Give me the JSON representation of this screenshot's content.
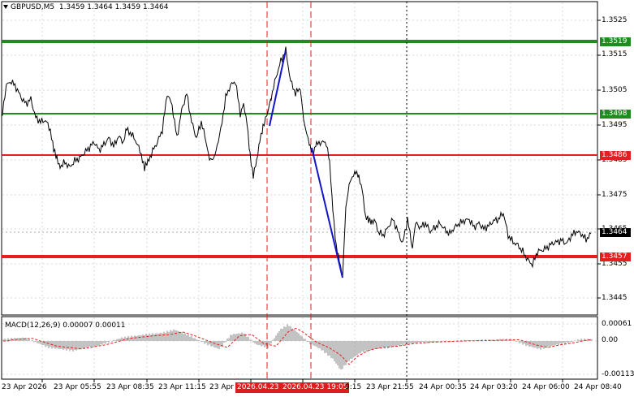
{
  "header": {
    "symbol": "GBPUSD,M5",
    "ohlc": "1.3459 1.3464 1.3459 1.3464"
  },
  "macd": {
    "label": "MACD(12,26,9) 0.00007 0.00011",
    "scale": [
      "0.00061",
      "0.00",
      "-0.00113"
    ]
  },
  "price_scale": [
    "1.3525",
    "1.3515",
    "1.3505",
    "1.3495",
    "1.3485",
    "1.3475",
    "1.3465",
    "1.3455",
    "1.3445"
  ],
  "levels": [
    {
      "value": "1.3519",
      "color": "#1e8c1e",
      "kind": "target"
    },
    {
      "value": "1.3498",
      "color": "#1e8c1e",
      "kind": "entry"
    },
    {
      "value": "1.3486",
      "color": "#e61e1e",
      "kind": "entry"
    },
    {
      "value": "1.3457",
      "color": "#e61e1e",
      "kind": "target"
    }
  ],
  "current_price": "1.3464",
  "time_labels": [
    "23 Apr 2026",
    "23 Apr 05:55",
    "23 Apr 08:35",
    "23 Apr 11:15",
    "23 Apr",
    "2026.04.23",
    "2026.04.23 19:05",
    "9:15",
    "23 Apr 21:55",
    "24 Apr 00:35",
    "24 Apr 03:20",
    "24 Apr 06:00",
    "24 Apr 08:40"
  ],
  "colors": {
    "green": "#1e8c1e",
    "red": "#e61e1e",
    "trend": "#1414c8",
    "macd_hist": "#b4b4b4",
    "macd_signal": "#e61e1e"
  }
}
